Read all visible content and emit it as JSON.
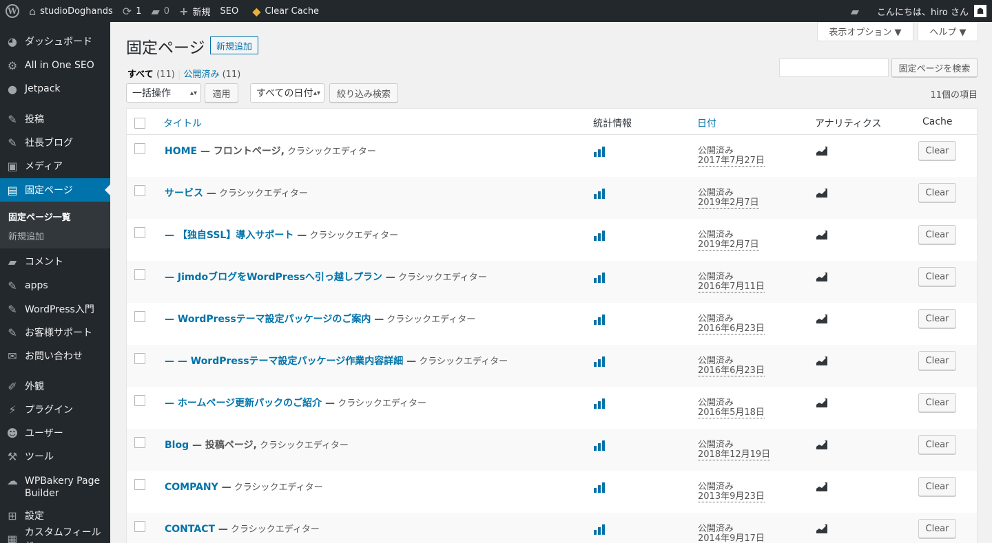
{
  "admin_bar": {
    "site_name": "studioDoghands",
    "updates_count": "1",
    "comments_count": "0",
    "new_label": "新規",
    "seo_label": "SEO",
    "clear_cache_label": "Clear Cache",
    "greeting": "こんにちは、hiro さん"
  },
  "sidebar": {
    "items": [
      {
        "label": "ダッシュボード",
        "icon": "dashboard-icon"
      },
      {
        "label": "All in One SEO",
        "icon": "gear-icon"
      },
      {
        "label": "Jetpack",
        "icon": "jetpack-icon"
      },
      {
        "label": "投稿",
        "icon": "pin-icon"
      },
      {
        "label": "社長ブログ",
        "icon": "pin-icon"
      },
      {
        "label": "メディア",
        "icon": "media-icon"
      },
      {
        "label": "固定ページ",
        "icon": "pages-icon"
      },
      {
        "label": "コメント",
        "icon": "comment-icon"
      },
      {
        "label": "apps",
        "icon": "pin-icon"
      },
      {
        "label": "WordPress入門",
        "icon": "pin-icon"
      },
      {
        "label": "お客様サポート",
        "icon": "pin-icon"
      },
      {
        "label": "お問い合わせ",
        "icon": "mail-icon"
      },
      {
        "label": "外観",
        "icon": "appearance-icon"
      },
      {
        "label": "プラグイン",
        "icon": "plugin-icon"
      },
      {
        "label": "ユーザー",
        "icon": "user-icon"
      },
      {
        "label": "ツール",
        "icon": "wrench-icon"
      },
      {
        "label": "WPBakery Page Builder",
        "icon": "cloud-icon"
      },
      {
        "label": "設定",
        "icon": "settings-icon"
      },
      {
        "label": "カスタムフィールド",
        "icon": "grid-icon"
      }
    ],
    "submenu": {
      "current": "固定ページ一覧",
      "add_new": "新規追加"
    }
  },
  "screen_meta": {
    "options": "表示オプション ▼",
    "help": "ヘルプ ▼"
  },
  "page": {
    "title": "固定ページ",
    "add_new": "新規追加",
    "filter_all": "すべて",
    "filter_all_count": "(11)",
    "filter_published": "公開済み",
    "filter_published_count": "(11)",
    "bulk_action": "一括操作",
    "apply": "適用",
    "date_filter": "すべての日付",
    "filter_button": "絞り込み検索",
    "search_button": "固定ページを検索",
    "items_count": "11個の項目"
  },
  "table": {
    "headers": {
      "title": "タイトル",
      "stats": "統計情報",
      "date": "日付",
      "analytics": "アナリティクス",
      "cache": "Cache"
    },
    "rows": [
      {
        "prefix": "",
        "title": "HOME",
        "state": " — フロントページ,",
        "editor": " クラシックエディター",
        "status": "公開済み",
        "date": "2017年7月27日",
        "button": "Clear"
      },
      {
        "prefix": "",
        "title": "サービス",
        "state": " —",
        "editor": " クラシックエディター",
        "status": "公開済み",
        "date": "2019年2月7日",
        "button": "Clear"
      },
      {
        "prefix": "",
        "title": "— 【独自SSL】導入サポート",
        "state": " —",
        "editor": " クラシックエディター",
        "status": "公開済み",
        "date": "2019年2月7日",
        "button": "Clear"
      },
      {
        "prefix": "",
        "title": "— JimdoブログをWordPressへ引っ越しプラン",
        "state": " —",
        "editor": " クラシックエディター",
        "status": "公開済み",
        "date": "2016年7月11日",
        "button": "Clear"
      },
      {
        "prefix": "",
        "title": "— WordPressテーマ設定パッケージのご案内",
        "state": " —",
        "editor": " クラシックエディター",
        "status": "公開済み",
        "date": "2016年6月23日",
        "button": "Clear"
      },
      {
        "prefix": "",
        "title": "— — WordPressテーマ設定パッケージ作業内容詳細",
        "state": " —",
        "editor": " クラシックエディター",
        "status": "公開済み",
        "date": "2016年6月23日",
        "button": "Clear"
      },
      {
        "prefix": "",
        "title": "— ホームページ更新パックのご紹介",
        "state": " —",
        "editor": " クラシックエディター",
        "status": "公開済み",
        "date": "2016年5月18日",
        "button": "Clear"
      },
      {
        "prefix": "",
        "title": "Blog",
        "state": " — 投稿ページ,",
        "editor": " クラシックエディター",
        "status": "公開済み",
        "date": "2018年12月19日",
        "button": "Clear"
      },
      {
        "prefix": "",
        "title": "COMPANY",
        "state": " —",
        "editor": " クラシックエディター",
        "status": "公開済み",
        "date": "2013年9月23日",
        "button": "Clear"
      },
      {
        "prefix": "",
        "title": "CONTACT",
        "state": " —",
        "editor": " クラシックエディター",
        "status": "公開済み",
        "date": "2014年9月17日",
        "button": "Clear"
      }
    ]
  }
}
